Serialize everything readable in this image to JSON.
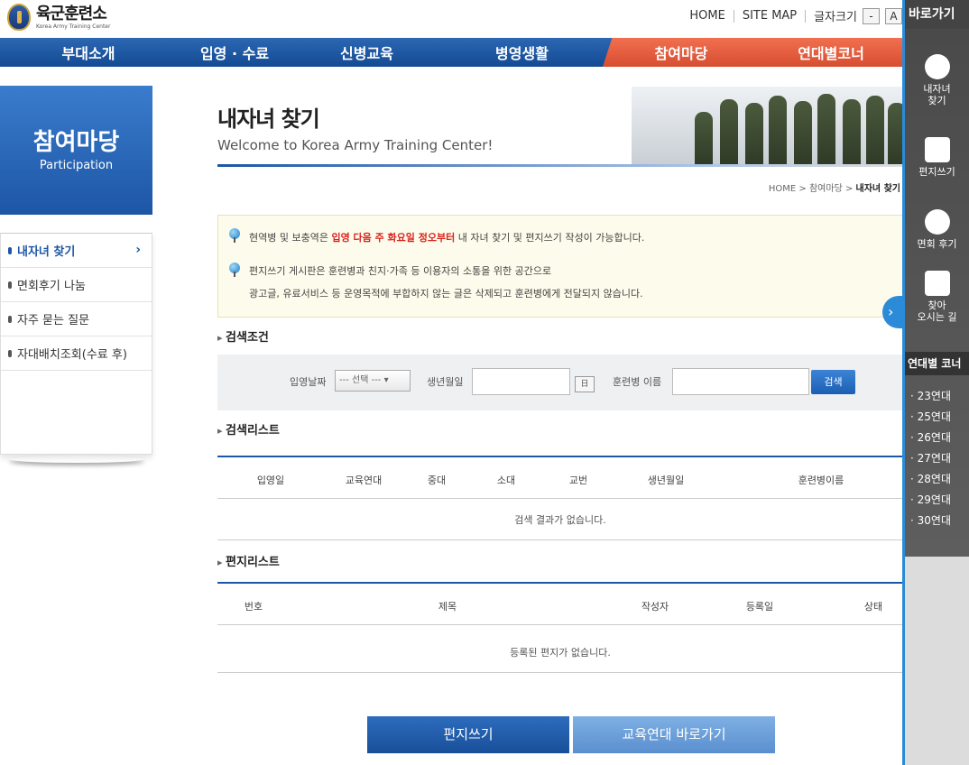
{
  "header": {
    "logo_main": "육군훈련소",
    "logo_sub": "Korea Army Training Center",
    "util": [
      "HOME",
      "SITE MAP",
      "글자크기"
    ],
    "font_minus": "-",
    "font_a": "A"
  },
  "nav": [
    "부대소개",
    "입영 · 수료",
    "신병교육",
    "병영생활",
    "참여마당",
    "연대별코너"
  ],
  "sidebar": {
    "title": "참여마당",
    "subtitle": "Participation",
    "items": [
      "내자녀 찾기",
      "면회후기 나눔",
      "자주 묻는 질문",
      "자대배치조회(수료 후)"
    ],
    "active_chevron": "›"
  },
  "page": {
    "title": "내자녀 찾기",
    "subtitle": "Welcome to Korea Army Training Center!",
    "breadcrumb_prefix": "HOME > 참여마당 > ",
    "breadcrumb_current": "내자녀 찾기"
  },
  "notice": {
    "line1_before": "현역병 및 보충역은 ",
    "line1_red": "입영 다음 주 화요일 정오부터",
    "line1_after": " 내 자녀 찾기 및 편지쓰기 작성이 가능합니다.",
    "line2": "편지쓰기 게시판은 훈련병과 친지·가족 등 이용자의 소통을 위한 공간으로",
    "line3": "광고글, 유료서비스 등 운영목적에 부합하지 않는 글은 삭제되고 훈련병에게 전달되지 않습니다."
  },
  "search": {
    "section_title": "검색조건",
    "label_date": "입영날짜",
    "select_value": "--- 선택 --- ▾",
    "label_birth": "생년월일",
    "calendar_label": "日",
    "label_name": "훈련병 이름",
    "button": "검색"
  },
  "results": {
    "section_title": "검색리스트",
    "columns": [
      "입영일",
      "교육연대",
      "중대",
      "소대",
      "교번",
      "생년월일",
      "훈련병이름"
    ],
    "empty": "검색 결과가 없습니다."
  },
  "letters": {
    "section_title": "편지리스트",
    "columns": [
      "번호",
      "제목",
      "작성자",
      "등록일",
      "상태"
    ],
    "empty": "등록된 편지가 없습니다."
  },
  "actions": {
    "write": "편지쓰기",
    "goto_unit": "교육연대 바로가기"
  },
  "quickbar": {
    "title": "바로가기",
    "items": [
      "내자녀\n찾기",
      "편지쓰기",
      "면회 후기",
      "찾아\n오시는 길"
    ],
    "era_head": "연대별 코너",
    "eras": [
      "· 23연대",
      "· 25연대",
      "· 26연대",
      "· 27연대",
      "· 28연대",
      "· 29연대",
      "· 30연대"
    ],
    "toggle": "›"
  },
  "colors": {
    "primary": "#1d56a5",
    "accent": "#d84d31",
    "highlight": "#d8221c",
    "quickbar_border": "#2b8bd8"
  }
}
